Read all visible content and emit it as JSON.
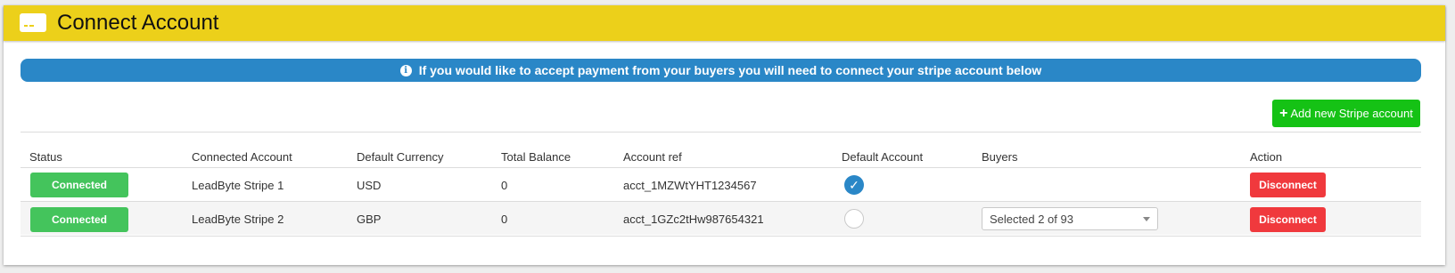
{
  "header": {
    "title": "Connect Account",
    "icon": "card-icon"
  },
  "info": {
    "text": "If you would like to accept payment from your buyers you will need to connect your stripe account below",
    "icon": "info-icon"
  },
  "actions": {
    "add_label": "Add new Stripe account"
  },
  "colors": {
    "header": "#ecd01a",
    "info": "#2a87c7",
    "add": "#15c215",
    "connected": "#44c45c",
    "disconnect": "#f0393d"
  },
  "table": {
    "columns": [
      "Status",
      "Connected Account",
      "Default Currency",
      "Total Balance",
      "Account ref",
      "Default Account",
      "Buyers",
      "Action"
    ],
    "rows": [
      {
        "status": "Connected",
        "account": "LeadByte Stripe 1",
        "currency": "USD",
        "balance": "0",
        "ref": "acct_1MZWtYHT1234567",
        "default": true,
        "buyers": "",
        "action": "Disconnect"
      },
      {
        "status": "Connected",
        "account": "LeadByte Stripe 2",
        "currency": "GBP",
        "balance": "0",
        "ref": "acct_1GZc2tHw987654321",
        "default": false,
        "buyers": "Selected 2 of 93",
        "action": "Disconnect"
      }
    ]
  }
}
